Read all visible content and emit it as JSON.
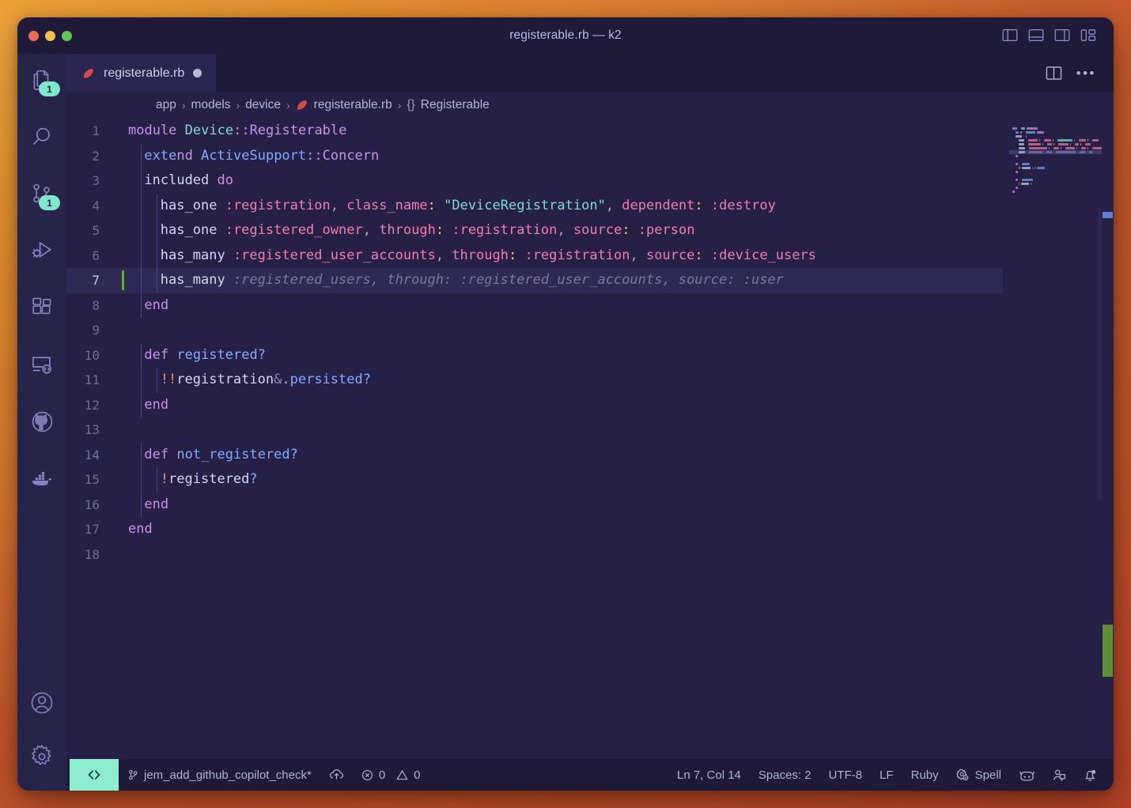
{
  "window": {
    "title": "registerable.rb — k2",
    "traffic_lights": [
      "close",
      "minimize",
      "zoom"
    ]
  },
  "titlebar_actions": [
    {
      "name": "toggle-primary-sidebar-icon",
      "label": "Toggle Primary Side Bar"
    },
    {
      "name": "toggle-panel-icon",
      "label": "Toggle Panel"
    },
    {
      "name": "toggle-secondary-sidebar-icon",
      "label": "Toggle Secondary Side Bar"
    },
    {
      "name": "customize-layout-icon",
      "label": "Customize Layout"
    }
  ],
  "activity_bar": {
    "items": [
      {
        "name": "explorer-icon",
        "label": "Explorer",
        "badge": "1"
      },
      {
        "name": "search-icon",
        "label": "Search",
        "badge": ""
      },
      {
        "name": "source-control-icon",
        "label": "Source Control",
        "badge": "1"
      },
      {
        "name": "run-and-debug-icon",
        "label": "Run and Debug",
        "badge": ""
      },
      {
        "name": "extensions-icon",
        "label": "Extensions",
        "badge": ""
      },
      {
        "name": "remote-explorer-icon",
        "label": "Remote Explorer",
        "badge": ""
      },
      {
        "name": "github-icon",
        "label": "GitHub",
        "badge": ""
      },
      {
        "name": "docker-icon",
        "label": "Docker",
        "badge": ""
      }
    ],
    "bottom_items": [
      {
        "name": "accounts-icon",
        "label": "Accounts"
      },
      {
        "name": "manage-settings-icon",
        "label": "Manage"
      }
    ]
  },
  "tab": {
    "label": "registerable.rb",
    "icon": "ruby-file-icon",
    "dirty": true
  },
  "editor_actions": [
    {
      "name": "split-editor-right-icon",
      "label": "Split Editor Right"
    },
    {
      "name": "more-actions-icon",
      "label": "More Actions...",
      "glyph": "•••"
    }
  ],
  "breadcrumbs": {
    "items": [
      "app",
      "models",
      "device",
      "registerable.rb",
      "Registerable"
    ],
    "separator": "›",
    "symbol_prefix": "{}"
  },
  "editor": {
    "language": "Ruby",
    "active_line": 7,
    "lines": [
      {
        "n": 1,
        "indent": 0,
        "tokens": [
          {
            "c": "t-kw",
            "t": "module"
          },
          {
            "c": "t-plain",
            "t": " "
          },
          {
            "c": "t-class",
            "t": "Device"
          },
          {
            "c": "t-const",
            "t": "::Registerable"
          }
        ]
      },
      {
        "n": 2,
        "indent": 1,
        "tokens": [
          {
            "c": "t-kw2",
            "t": "exte"
          },
          {
            "c": "t-kw",
            "t": "nd"
          },
          {
            "c": "t-plain",
            "t": " "
          },
          {
            "c": "t-kw2",
            "t": "ActiveSupport"
          },
          {
            "c": "t-const",
            "t": "::Concern"
          }
        ]
      },
      {
        "n": 3,
        "indent": 1,
        "tokens": [
          {
            "c": "t-var",
            "t": "included"
          },
          {
            "c": "t-plain",
            "t": " "
          },
          {
            "c": "t-kw",
            "t": "do"
          }
        ]
      },
      {
        "n": 4,
        "indent": 2,
        "tokens": [
          {
            "c": "t-var",
            "t": "has_one"
          },
          {
            "c": "t-plain",
            "t": " "
          },
          {
            "c": "t-sym",
            "t": ":registration"
          },
          {
            "c": "t-punc",
            "t": ", "
          },
          {
            "c": "t-key",
            "t": "class_name"
          },
          {
            "c": "t-colon",
            "t": ":"
          },
          {
            "c": "t-plain",
            "t": " "
          },
          {
            "c": "t-str",
            "t": "\"DeviceRegistration\""
          },
          {
            "c": "t-punc",
            "t": ", "
          },
          {
            "c": "t-key",
            "t": "dependent"
          },
          {
            "c": "t-colon",
            "t": ":"
          },
          {
            "c": "t-plain",
            "t": " "
          },
          {
            "c": "t-sym",
            "t": ":destroy"
          }
        ]
      },
      {
        "n": 5,
        "indent": 2,
        "tokens": [
          {
            "c": "t-var",
            "t": "has_one"
          },
          {
            "c": "t-plain",
            "t": " "
          },
          {
            "c": "t-sym",
            "t": ":registered_owner"
          },
          {
            "c": "t-punc",
            "t": ", "
          },
          {
            "c": "t-key",
            "t": "through"
          },
          {
            "c": "t-colon",
            "t": ":"
          },
          {
            "c": "t-plain",
            "t": " "
          },
          {
            "c": "t-sym",
            "t": ":registration"
          },
          {
            "c": "t-punc",
            "t": ", "
          },
          {
            "c": "t-key",
            "t": "source"
          },
          {
            "c": "t-colon",
            "t": ":"
          },
          {
            "c": "t-plain",
            "t": " "
          },
          {
            "c": "t-sym",
            "t": ":person"
          }
        ]
      },
      {
        "n": 6,
        "indent": 2,
        "tokens": [
          {
            "c": "t-var",
            "t": "has_many"
          },
          {
            "c": "t-plain",
            "t": " "
          },
          {
            "c": "t-sym",
            "t": ":registered_user_accounts"
          },
          {
            "c": "t-punc",
            "t": ", "
          },
          {
            "c": "t-key",
            "t": "through"
          },
          {
            "c": "t-colon",
            "t": ":"
          },
          {
            "c": "t-plain",
            "t": " "
          },
          {
            "c": "t-sym",
            "t": ":registration"
          },
          {
            "c": "t-punc",
            "t": ", "
          },
          {
            "c": "t-key",
            "t": "source"
          },
          {
            "c": "t-colon",
            "t": ":"
          },
          {
            "c": "t-plain",
            "t": " "
          },
          {
            "c": "t-sym",
            "t": ":device_users"
          }
        ]
      },
      {
        "n": 7,
        "indent": 2,
        "tokens": [
          {
            "c": "t-var",
            "t": "has_many"
          },
          {
            "c": "ghost",
            "t": " :registered_users, through: :registered_user_accounts, source: :user"
          }
        ]
      },
      {
        "n": 8,
        "indent": 1,
        "tokens": [
          {
            "c": "t-kw",
            "t": "end"
          }
        ]
      },
      {
        "n": 9,
        "indent": 0,
        "tokens": []
      },
      {
        "n": 10,
        "indent": 1,
        "tokens": [
          {
            "c": "t-kw",
            "t": "def"
          },
          {
            "c": "t-plain",
            "t": " "
          },
          {
            "c": "t-fn",
            "t": "registered?"
          }
        ]
      },
      {
        "n": 11,
        "indent": 2,
        "tokens": [
          {
            "c": "t-op",
            "t": "!!"
          },
          {
            "c": "t-var",
            "t": "registration"
          },
          {
            "c": "t-amp",
            "t": "&"
          },
          {
            "c": "t-punc",
            "t": "."
          },
          {
            "c": "t-fn",
            "t": "persisted?"
          }
        ]
      },
      {
        "n": 12,
        "indent": 1,
        "tokens": [
          {
            "c": "t-kw",
            "t": "end"
          }
        ]
      },
      {
        "n": 13,
        "indent": 0,
        "tokens": []
      },
      {
        "n": 14,
        "indent": 1,
        "tokens": [
          {
            "c": "t-kw",
            "t": "def"
          },
          {
            "c": "t-plain",
            "t": " "
          },
          {
            "c": "t-fn",
            "t": "not_registered?"
          }
        ]
      },
      {
        "n": 15,
        "indent": 2,
        "tokens": [
          {
            "c": "t-op",
            "t": "!"
          },
          {
            "c": "t-var",
            "t": "registered"
          },
          {
            "c": "t-fn",
            "t": "?"
          }
        ]
      },
      {
        "n": 16,
        "indent": 1,
        "tokens": [
          {
            "c": "t-kw",
            "t": "end"
          }
        ]
      },
      {
        "n": 17,
        "indent": 0,
        "tokens": [
          {
            "c": "t-kw",
            "t": "end"
          }
        ]
      },
      {
        "n": 18,
        "indent": 0,
        "tokens": []
      }
    ]
  },
  "status_bar": {
    "remote_label": "><",
    "branch": "jem_add_github_copilot_check*",
    "sync_icon": "cloud-upload-icon",
    "errors": "0",
    "warnings": "0",
    "position": "Ln 7, Col 14",
    "indentation": "Spaces: 2",
    "encoding": "UTF-8",
    "eol": "LF",
    "language": "Ruby",
    "spell": "Spell",
    "right_icons": [
      {
        "name": "copilot-icon"
      },
      {
        "name": "live-share-icon"
      },
      {
        "name": "notifications-bell-icon"
      }
    ]
  },
  "colors": {
    "desktop_gradient_start": "#f0a83c",
    "desktop_gradient_end": "#b9452a",
    "window_bg": "#221d3c",
    "editor_bg": "#262046",
    "activity_bar_bg": "#282349",
    "titlebar_bg": "#1f1a38",
    "tab_active_bg": "#2b2551",
    "badge_bg": "#7fe7cd",
    "remote_bg": "#8ceccf",
    "cursor": "#6ba644",
    "active_line_bg": "#2f2955"
  }
}
